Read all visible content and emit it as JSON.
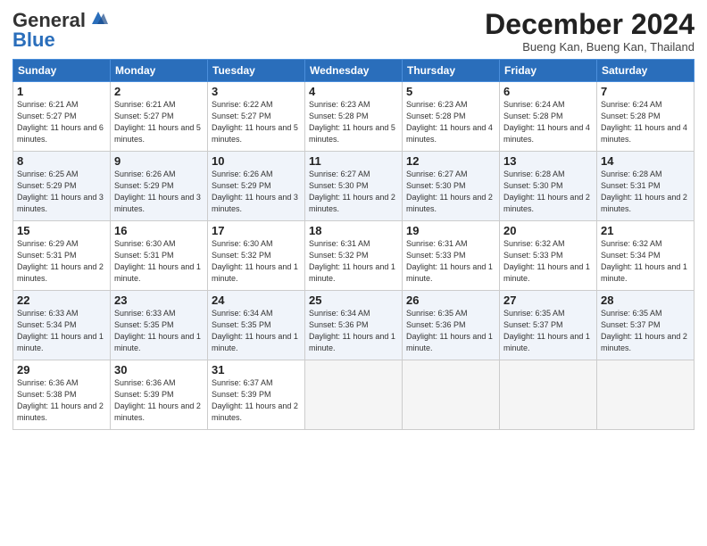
{
  "header": {
    "logo_general": "General",
    "logo_blue": "Blue",
    "month_title": "December 2024",
    "location": "Bueng Kan, Bueng Kan, Thailand"
  },
  "days_of_week": [
    "Sunday",
    "Monday",
    "Tuesday",
    "Wednesday",
    "Thursday",
    "Friday",
    "Saturday"
  ],
  "weeks": [
    [
      {
        "day": "1",
        "sunrise": "6:21 AM",
        "sunset": "5:27 PM",
        "daylight": "11 hours and 6 minutes."
      },
      {
        "day": "2",
        "sunrise": "6:21 AM",
        "sunset": "5:27 PM",
        "daylight": "11 hours and 5 minutes."
      },
      {
        "day": "3",
        "sunrise": "6:22 AM",
        "sunset": "5:27 PM",
        "daylight": "11 hours and 5 minutes."
      },
      {
        "day": "4",
        "sunrise": "6:23 AM",
        "sunset": "5:28 PM",
        "daylight": "11 hours and 5 minutes."
      },
      {
        "day": "5",
        "sunrise": "6:23 AM",
        "sunset": "5:28 PM",
        "daylight": "11 hours and 4 minutes."
      },
      {
        "day": "6",
        "sunrise": "6:24 AM",
        "sunset": "5:28 PM",
        "daylight": "11 hours and 4 minutes."
      },
      {
        "day": "7",
        "sunrise": "6:24 AM",
        "sunset": "5:28 PM",
        "daylight": "11 hours and 4 minutes."
      }
    ],
    [
      {
        "day": "8",
        "sunrise": "6:25 AM",
        "sunset": "5:29 PM",
        "daylight": "11 hours and 3 minutes."
      },
      {
        "day": "9",
        "sunrise": "6:26 AM",
        "sunset": "5:29 PM",
        "daylight": "11 hours and 3 minutes."
      },
      {
        "day": "10",
        "sunrise": "6:26 AM",
        "sunset": "5:29 PM",
        "daylight": "11 hours and 3 minutes."
      },
      {
        "day": "11",
        "sunrise": "6:27 AM",
        "sunset": "5:30 PM",
        "daylight": "11 hours and 2 minutes."
      },
      {
        "day": "12",
        "sunrise": "6:27 AM",
        "sunset": "5:30 PM",
        "daylight": "11 hours and 2 minutes."
      },
      {
        "day": "13",
        "sunrise": "6:28 AM",
        "sunset": "5:30 PM",
        "daylight": "11 hours and 2 minutes."
      },
      {
        "day": "14",
        "sunrise": "6:28 AM",
        "sunset": "5:31 PM",
        "daylight": "11 hours and 2 minutes."
      }
    ],
    [
      {
        "day": "15",
        "sunrise": "6:29 AM",
        "sunset": "5:31 PM",
        "daylight": "11 hours and 2 minutes."
      },
      {
        "day": "16",
        "sunrise": "6:30 AM",
        "sunset": "5:31 PM",
        "daylight": "11 hours and 1 minute."
      },
      {
        "day": "17",
        "sunrise": "6:30 AM",
        "sunset": "5:32 PM",
        "daylight": "11 hours and 1 minute."
      },
      {
        "day": "18",
        "sunrise": "6:31 AM",
        "sunset": "5:32 PM",
        "daylight": "11 hours and 1 minute."
      },
      {
        "day": "19",
        "sunrise": "6:31 AM",
        "sunset": "5:33 PM",
        "daylight": "11 hours and 1 minute."
      },
      {
        "day": "20",
        "sunrise": "6:32 AM",
        "sunset": "5:33 PM",
        "daylight": "11 hours and 1 minute."
      },
      {
        "day": "21",
        "sunrise": "6:32 AM",
        "sunset": "5:34 PM",
        "daylight": "11 hours and 1 minute."
      }
    ],
    [
      {
        "day": "22",
        "sunrise": "6:33 AM",
        "sunset": "5:34 PM",
        "daylight": "11 hours and 1 minute."
      },
      {
        "day": "23",
        "sunrise": "6:33 AM",
        "sunset": "5:35 PM",
        "daylight": "11 hours and 1 minute."
      },
      {
        "day": "24",
        "sunrise": "6:34 AM",
        "sunset": "5:35 PM",
        "daylight": "11 hours and 1 minute."
      },
      {
        "day": "25",
        "sunrise": "6:34 AM",
        "sunset": "5:36 PM",
        "daylight": "11 hours and 1 minute."
      },
      {
        "day": "26",
        "sunrise": "6:35 AM",
        "sunset": "5:36 PM",
        "daylight": "11 hours and 1 minute."
      },
      {
        "day": "27",
        "sunrise": "6:35 AM",
        "sunset": "5:37 PM",
        "daylight": "11 hours and 1 minute."
      },
      {
        "day": "28",
        "sunrise": "6:35 AM",
        "sunset": "5:37 PM",
        "daylight": "11 hours and 2 minutes."
      }
    ],
    [
      {
        "day": "29",
        "sunrise": "6:36 AM",
        "sunset": "5:38 PM",
        "daylight": "11 hours and 2 minutes."
      },
      {
        "day": "30",
        "sunrise": "6:36 AM",
        "sunset": "5:39 PM",
        "daylight": "11 hours and 2 minutes."
      },
      {
        "day": "31",
        "sunrise": "6:37 AM",
        "sunset": "5:39 PM",
        "daylight": "11 hours and 2 minutes."
      },
      null,
      null,
      null,
      null
    ]
  ]
}
